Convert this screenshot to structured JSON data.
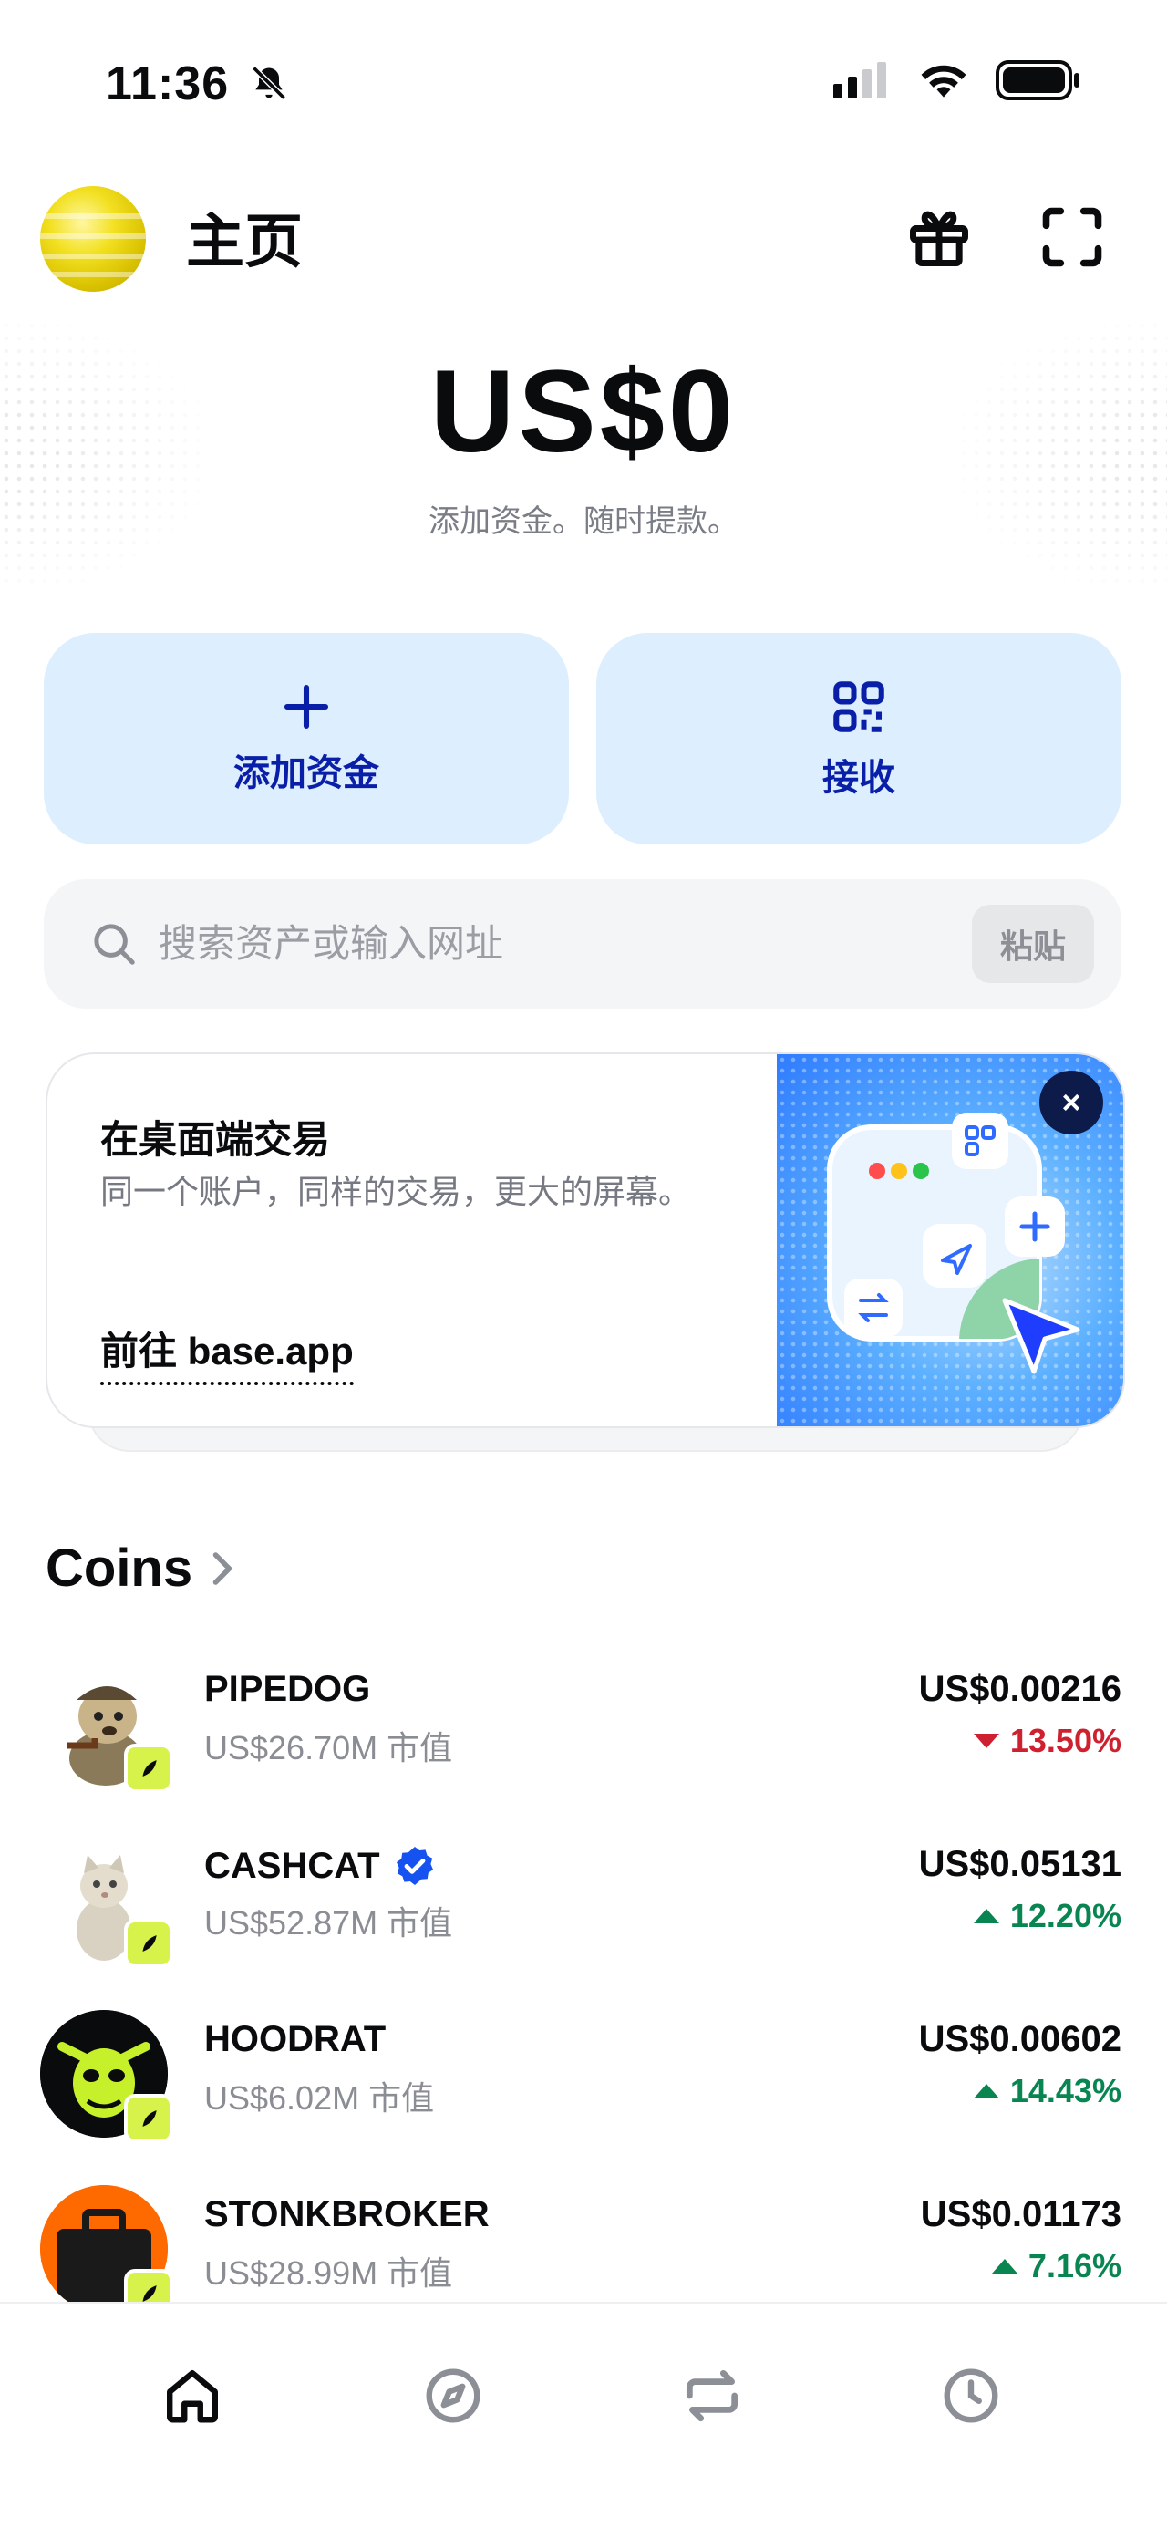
{
  "status_bar": {
    "time": "11:36"
  },
  "header": {
    "title": "主页"
  },
  "balance": {
    "amount": "US$0",
    "subtitle": "添加资金。随时提款。"
  },
  "actions": {
    "add_funds_label": "添加资金",
    "receive_label": "接收"
  },
  "search": {
    "placeholder": "搜索资产或输入网址",
    "value": "",
    "paste_label": "粘贴"
  },
  "promo": {
    "title": "在桌面端交易",
    "description": "同一个账户，同样的交易，更大的屏幕。",
    "link_label": "前往 base.app",
    "close_glyph": "×"
  },
  "coins": {
    "section_title": "Coins",
    "items": [
      {
        "name": "PIPEDOG",
        "market_cap": "US$26.70M 市值",
        "price": "US$0.00216",
        "change": "13.50%",
        "direction": "down",
        "verified": false
      },
      {
        "name": "CASHCAT",
        "market_cap": "US$52.87M 市值",
        "price": "US$0.05131",
        "change": "12.20%",
        "direction": "up",
        "verified": true
      },
      {
        "name": "HOODRAT",
        "market_cap": "US$6.02M 市值",
        "price": "US$0.00602",
        "change": "14.43%",
        "direction": "up",
        "verified": false
      },
      {
        "name": "STONKBROKER",
        "market_cap": "US$28.99M 市值",
        "price": "US$0.01173",
        "change": "7.16%",
        "direction": "up",
        "verified": false
      }
    ]
  },
  "nav": {
    "items": [
      {
        "icon": "home-icon",
        "active": true
      },
      {
        "icon": "compass-icon",
        "active": false
      },
      {
        "icon": "swap-icon",
        "active": false
      },
      {
        "icon": "clock-icon",
        "active": false
      }
    ]
  },
  "colors": {
    "accent": "#0a1fa8",
    "action_bg": "#ddeeff",
    "up": "#098551",
    "down": "#cf202f",
    "badge": "#d7f34b"
  }
}
